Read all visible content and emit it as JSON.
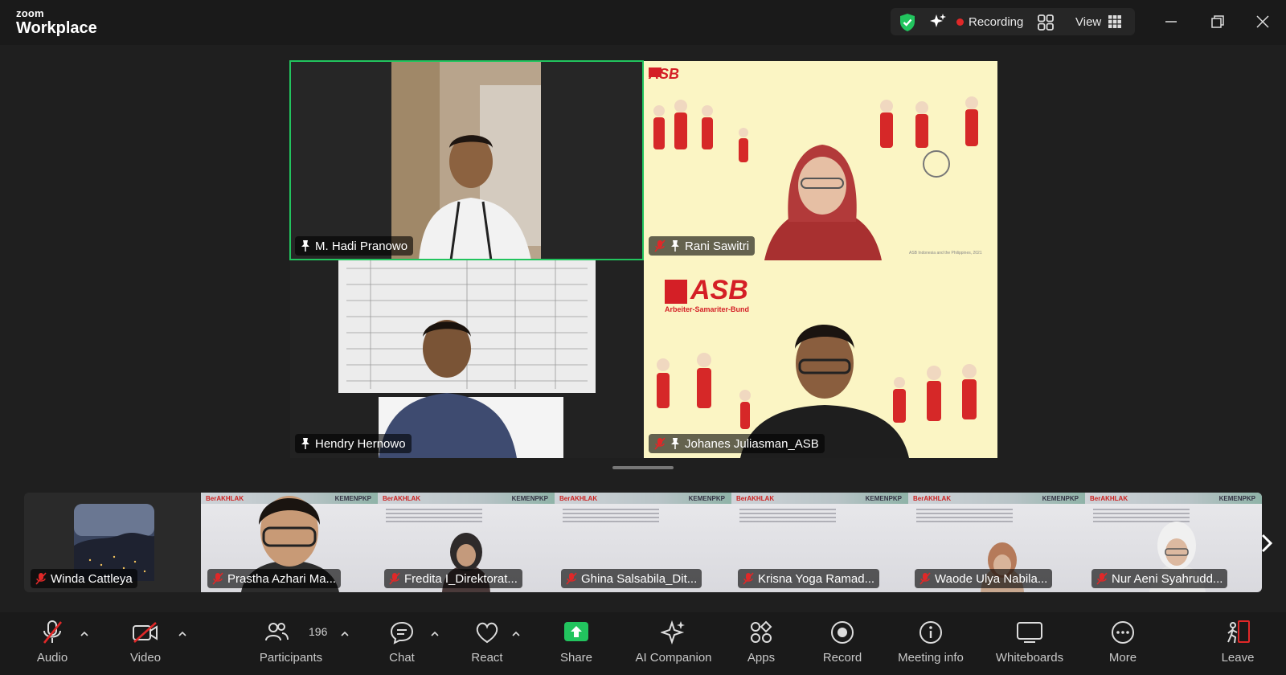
{
  "app": {
    "logo_top": "zoom",
    "logo_bottom": "Workplace",
    "recording_label": "Recording",
    "view_label": "View"
  },
  "colors": {
    "active_speaker": "#22c45e",
    "recording_dot": "#e02828",
    "share_green": "#22c45e",
    "mute_red": "#e02828",
    "slide_yellow": "#fbf5c4"
  },
  "main_tiles": [
    {
      "name": "M. Hadi Pranowo",
      "muted": false,
      "pinned": true,
      "active": true
    },
    {
      "name": "Rani Sawitri",
      "muted": true,
      "pinned": true,
      "active": false
    },
    {
      "name": "Hendry Hernowo",
      "muted": false,
      "pinned": true,
      "active": false
    },
    {
      "name": "Johanes Juliasman_ASB",
      "muted": true,
      "pinned": true,
      "active": false
    }
  ],
  "slide_text": {
    "asb_logo": "ASB",
    "asb_sub": "Arbeiter-Samariter-Bund",
    "slide_kemen": "KEMENPKP",
    "slide_berakhlak": "BerAKHLAK"
  },
  "gallery": [
    {
      "name": "Winda Cattleya",
      "muted": true
    },
    {
      "name": "Prastha Azhari Ma...",
      "muted": true
    },
    {
      "name": "Fredita I_Direktorat...",
      "muted": true
    },
    {
      "name": "Ghina Salsabila_Dit...",
      "muted": true
    },
    {
      "name": "Krisna Yoga Ramad...",
      "muted": true
    },
    {
      "name": "Waode Ulya Nabila...",
      "muted": true
    },
    {
      "name": "Nur Aeni Syahrudd...",
      "muted": true
    }
  ],
  "toolbar": {
    "audio": "Audio",
    "video": "Video",
    "participants": "Participants",
    "participants_count": "196",
    "chat": "Chat",
    "react": "React",
    "share": "Share",
    "ai_companion": "AI Companion",
    "apps": "Apps",
    "record": "Record",
    "meeting_info": "Meeting info",
    "whiteboards": "Whiteboards",
    "more": "More",
    "leave": "Leave"
  }
}
